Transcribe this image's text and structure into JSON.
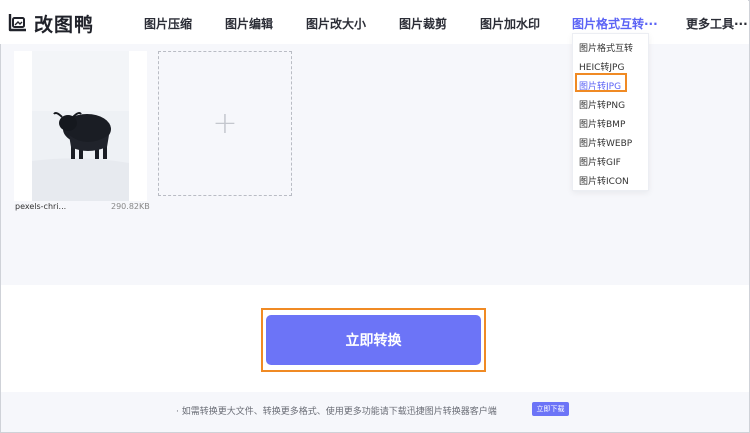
{
  "header": {
    "logo_text": "改图鸭",
    "nav": [
      {
        "label": "图片压缩"
      },
      {
        "label": "图片编辑"
      },
      {
        "label": "图片改大小"
      },
      {
        "label": "图片裁剪"
      },
      {
        "label": "图片加水印"
      },
      {
        "label": "图片格式互转···"
      },
      {
        "label": "更多工具···"
      }
    ]
  },
  "upload": {
    "file_name": "pexels-chri...",
    "file_size": "290.82KB",
    "add_symbol": "+"
  },
  "dropdown": {
    "items": [
      {
        "label": "图片格式互转"
      },
      {
        "label": "HEIC转JPG"
      },
      {
        "label": "图片转JPG"
      },
      {
        "label": "图片转PNG"
      },
      {
        "label": "图片转BMP"
      },
      {
        "label": "图片转WEBP"
      },
      {
        "label": "图片转GIF"
      },
      {
        "label": "图片转ICON"
      }
    ],
    "selected_index": 2
  },
  "actions": {
    "convert_label": "立即转换"
  },
  "footer": {
    "tip": "· 如需转换更大文件、转换更多格式、使用更多功能请下载迅捷图片转换器客户端",
    "download_label": "立即下载"
  },
  "colors": {
    "accent": "#6c74f7",
    "highlight": "#f08a24"
  }
}
